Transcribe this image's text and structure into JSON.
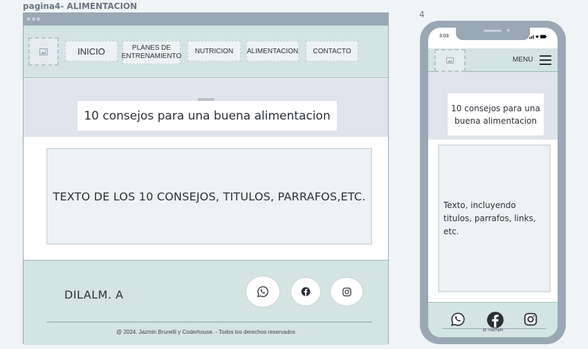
{
  "page_label": "pagina4- ALIMENTACION",
  "frame_number": "4",
  "desktop": {
    "nav": {
      "logo_icon": "image-icon",
      "items": [
        {
          "label": "INICIO"
        },
        {
          "label": "PLANES DE\nENTRENAMIENTO"
        },
        {
          "label": "NUTRICION"
        },
        {
          "label": "ALIMENTACION"
        },
        {
          "label": "CONTACTO"
        }
      ]
    },
    "hero_title": "10 consejos para una buena alimentacion",
    "content_text": "TEXTO DE LOS 10 CONSEJOS, TITULOS, PARRAFOS,ETC.",
    "footer": {
      "brand": "DILALM. A",
      "social_icons": [
        "whatsapp-icon",
        "facebook-icon",
        "instagram-icon"
      ],
      "copyright": "@ 2024.  Jazmin Brunelli  y Coderhouse. - Todos los derechos  reservados"
    }
  },
  "mobile": {
    "time": "3:03",
    "menu_label": "MENU",
    "hero_title": "10 consejos para una buena alimentacion",
    "content_text": "Texto, incluyendo titulos, parrafos, links, etc.",
    "footer": {
      "social_icons": [
        "whatsapp-icon",
        "facebook-icon",
        "instagram-icon"
      ],
      "copyright": "@ copyright"
    }
  },
  "colors": {
    "nav_bg": "#d3e4e2",
    "hero_bg": "#e0e4ec",
    "frame_gray": "#9aa8b5",
    "text": "#2b2f36"
  }
}
